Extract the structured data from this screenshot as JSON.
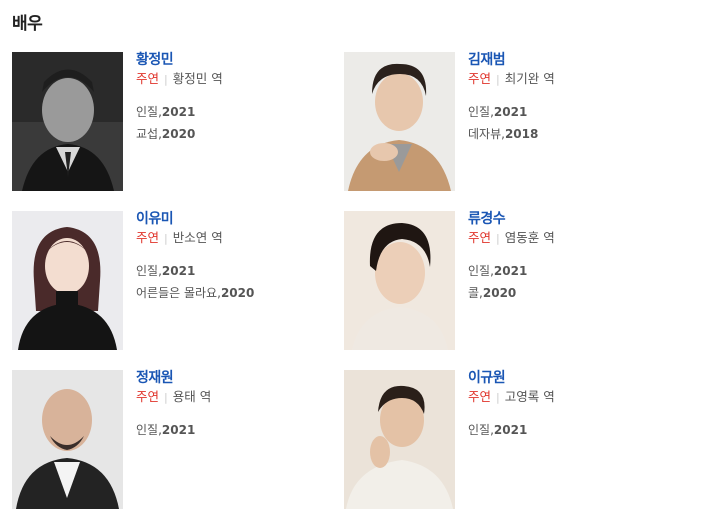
{
  "section": {
    "title": "배우"
  },
  "actors": [
    {
      "name": "황정민",
      "role_type": "주연",
      "role": "황정민 역",
      "works": [
        {
          "title": "인질",
          "year": "2021"
        },
        {
          "title": "교섭",
          "year": "2020"
        }
      ]
    },
    {
      "name": "김재범",
      "role_type": "주연",
      "role": "최기완 역",
      "works": [
        {
          "title": "인질",
          "year": "2021"
        },
        {
          "title": "데자뷰",
          "year": "2018"
        }
      ]
    },
    {
      "name": "이유미",
      "role_type": "주연",
      "role": "반소연 역",
      "works": [
        {
          "title": "인질",
          "year": "2021"
        },
        {
          "title": "어른들은 몰라요",
          "year": "2020"
        }
      ]
    },
    {
      "name": "류경수",
      "role_type": "주연",
      "role": "염동훈 역",
      "works": [
        {
          "title": "인질",
          "year": "2021"
        },
        {
          "title": "콜",
          "year": "2020"
        }
      ]
    },
    {
      "name": "정재원",
      "role_type": "주연",
      "role": "용태 역",
      "works": [
        {
          "title": "인질",
          "year": "2021"
        }
      ]
    },
    {
      "name": "이규원",
      "role_type": "주연",
      "role": "고영록 역",
      "works": [
        {
          "title": "인질",
          "year": "2021"
        }
      ]
    }
  ],
  "year_prefix": ","
}
